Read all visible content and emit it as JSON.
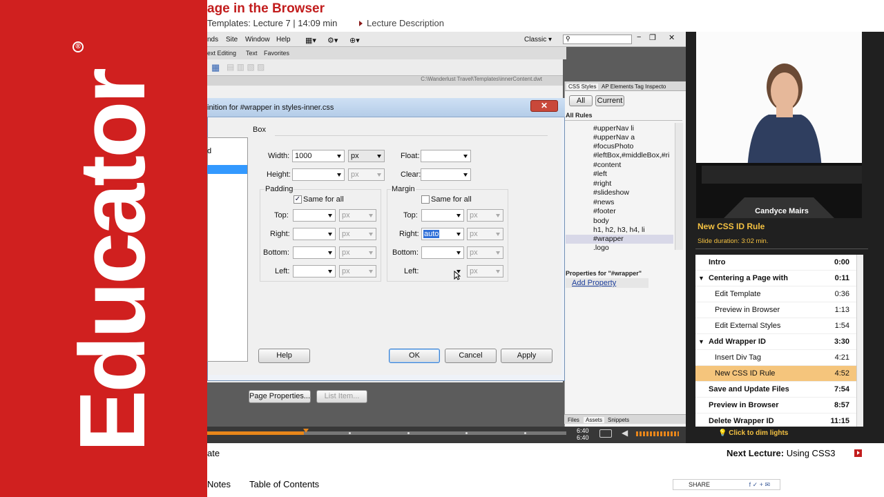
{
  "brand": {
    "logo_text": "Educator",
    "reg_mark": "®"
  },
  "header": {
    "title": "age in the Browser",
    "subtitle": "Templates: Lecture 7 | 14:09 min",
    "description_link": "Lecture Description"
  },
  "dreamweaver": {
    "menu": [
      "nds",
      "Site",
      "Window",
      "Help"
    ],
    "workspace": "Classic",
    "search_placeholder": "",
    "doc_tabs": [
      "ext Editing",
      "Text",
      "Favorites"
    ],
    "doc_path": "C:\\Wanderlust Travel\\Templates\\innerContent.dwt",
    "page_properties_button": "Page Properties...",
    "list_item_button": "List Item..."
  },
  "css_panel": {
    "tabs": [
      "CSS Styles",
      "AP Elements",
      "Tag Inspecto"
    ],
    "mode_all": "All",
    "mode_current": "Current",
    "all_rules_label": "All Rules",
    "rules": [
      "#upperNav li",
      "#upperNav a",
      "#focusPhoto",
      "#leftBox,#middleBox,#ri",
      "#content",
      "#left",
      "#right",
      "#slideshow",
      "#news",
      "#footer",
      "body",
      "h1, h2, h3, h4, li",
      "#wrapper",
      ".logo"
    ],
    "selected_rule": "#wrapper",
    "properties_label": "Properties for \"#wrapper\"",
    "add_property": "Add Property",
    "bottom_tabs": [
      "Files",
      "Assets",
      "Snippets"
    ]
  },
  "dialog": {
    "title": "inition for #wrapper in styles-inner.css",
    "category_item": "d",
    "section": "Box",
    "width_label": "Width:",
    "width_value": "1000",
    "width_unit": "px",
    "height_label": "Height:",
    "height_unit": "px",
    "float_label": "Float:",
    "clear_label": "Clear:",
    "padding_label": "Padding",
    "margin_label": "Margin",
    "same_for_all": "Same for all",
    "padding_same_checked": true,
    "margin_same_checked": false,
    "top_label": "Top:",
    "right_label": "Right:",
    "bottom_label": "Bottom:",
    "left_label": "Left:",
    "unit_px": "px",
    "margin_right_value": "auto",
    "buttons": {
      "help": "Help",
      "ok": "OK",
      "cancel": "Cancel",
      "apply": "Apply"
    }
  },
  "timeline": {
    "time_top": "6:40",
    "time_bottom": "6:40",
    "progress": 0.27
  },
  "video": {
    "presenter": "Candyce Mairs"
  },
  "slide": {
    "title": "New CSS ID Rule",
    "duration": "Slide duration: 3:02 min."
  },
  "toc": [
    {
      "title": "Intro",
      "time": "0:00",
      "bold": true,
      "indent": 0
    },
    {
      "title": "Centering a Page with",
      "time": "0:11",
      "bold": true,
      "indent": 0,
      "expanded": true
    },
    {
      "title": "Edit Template",
      "time": "0:36",
      "bold": false,
      "indent": 1
    },
    {
      "title": "Preview in Browser",
      "time": "1:13",
      "bold": false,
      "indent": 1
    },
    {
      "title": "Edit External Styles",
      "time": "1:54",
      "bold": false,
      "indent": 1
    },
    {
      "title": "Add Wrapper ID",
      "time": "3:30",
      "bold": true,
      "indent": 0,
      "expanded": true
    },
    {
      "title": "Insert Div Tag",
      "time": "4:21",
      "bold": false,
      "indent": 1
    },
    {
      "title": "New CSS ID Rule",
      "time": "4:52",
      "bold": false,
      "indent": 1,
      "active": true
    },
    {
      "title": "Save and Update Files",
      "time": "7:54",
      "bold": true,
      "indent": 0
    },
    {
      "title": "Preview in Browser",
      "time": "8:57",
      "bold": true,
      "indent": 0
    },
    {
      "title": "Delete Wrapper ID",
      "time": "11:15",
      "bold": true,
      "indent": 0
    }
  ],
  "dim_lights": "Click to dim lights",
  "bottom": {
    "left_fragment": "ate",
    "next_label": "Next Lecture:",
    "next_title": "Using CSS3",
    "tab_notes": "Notes",
    "tab_toc": "Table of Contents",
    "share": "SHARE"
  },
  "colors": {
    "brand_red": "#d0201f",
    "accent_orange": "#e8861a",
    "highlight": "#f5c57c",
    "slide_yellow": "#f5c242"
  }
}
